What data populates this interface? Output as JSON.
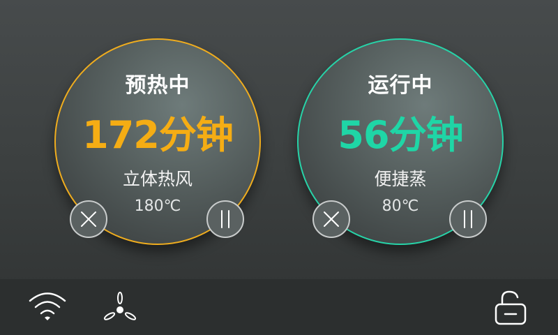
{
  "cooking_zones": [
    {
      "status": "预热中",
      "remaining_time": "172分钟",
      "mode": "立体热风",
      "temperature": "180℃",
      "accent_color": "#f0ad1e",
      "cancel_icon": "close-icon",
      "pause_icon": "pause-icon"
    },
    {
      "status": "运行中",
      "remaining_time": "56分钟",
      "mode": "便捷蒸",
      "temperature": "80℃",
      "accent_color": "#27d3a8",
      "cancel_icon": "close-icon",
      "pause_icon": "pause-icon"
    }
  ],
  "bottom_bar": {
    "icons": [
      "wifi-icon",
      "fan-icon",
      "lock-icon"
    ]
  }
}
